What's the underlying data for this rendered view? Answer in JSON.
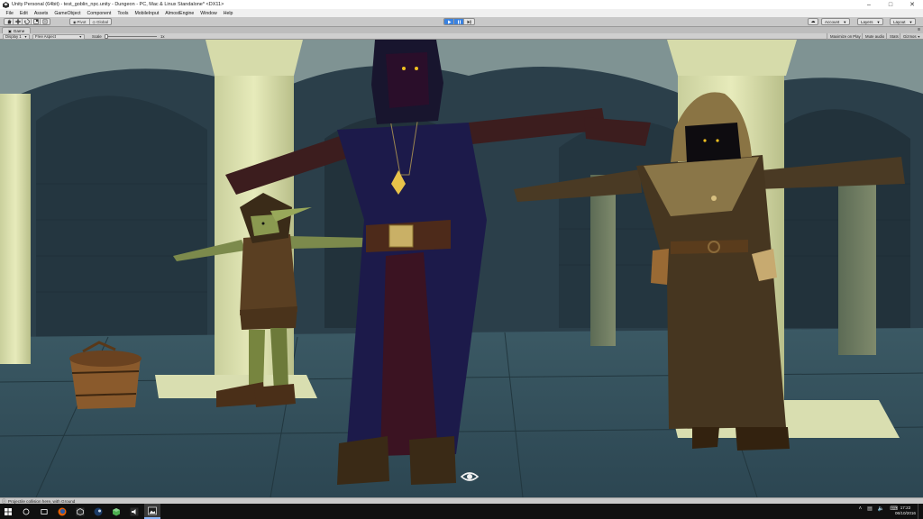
{
  "window": {
    "title": "Unity Personal (64bit) - test_goblin_npc.unity - Dungeon - PC, Mac & Linux Standalone* <DX11>",
    "controls": {
      "minimize": "–",
      "maximize": "□",
      "close": "✕"
    }
  },
  "menu": [
    "File",
    "Edit",
    "Assets",
    "GameObject",
    "Component",
    "Tools",
    "MobileInput",
    "AlmostEngine",
    "Window",
    "Help"
  ],
  "toolbar": {
    "pivot_label": "Pivot",
    "global_label": "Global",
    "account_label": "Account",
    "layers_label": "Layers",
    "layout_label": "Layout",
    "active_tool": "play",
    "accent_color": "#3a82e0"
  },
  "game_view": {
    "tab_label": "Game",
    "display_label": "Display 1",
    "aspect_label": "Free Aspect",
    "scale_label": "Scale",
    "scale_value": "1x",
    "maximize_on_play": "Maximize on Play",
    "mute_audio": "Mute audio",
    "stats": "Stats",
    "gizmos": "Gizmos"
  },
  "status": {
    "message": "Projectile collision here, with Ground",
    "warning_icon": "warning-icon"
  },
  "taskbar": {
    "items": [
      "start-icon",
      "search-icon",
      "task-view-icon",
      "firefox-icon",
      "unity-icon",
      "steam-icon",
      "package-icon",
      "volume-app-icon",
      "photos-icon"
    ],
    "active_index": 8,
    "time": "17:22",
    "date": "06/10/2016",
    "background": "#101010"
  }
}
